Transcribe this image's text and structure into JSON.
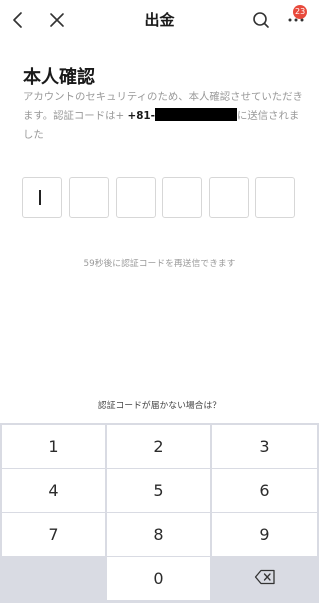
{
  "header": {
    "title": "出金",
    "badge": "23",
    "back_icon": "chevron-left-icon",
    "close_icon": "close-icon",
    "search_icon": "search-icon",
    "more_icon": "more-icon"
  },
  "main": {
    "heading": "本人確認",
    "description_prefix": "アカウントのセキュリティのため、本人確認させていただきます。認証コードは+ ",
    "phone_prefix": "+81-",
    "description_suffix": "に送信されました",
    "resend_text": "59秒後に認証コードを再送信できます",
    "help_text": "認証コードが届かない場合は？",
    "code_boxes": [
      "",
      "",
      "",
      "",
      "",
      ""
    ]
  },
  "keypad": {
    "keys": [
      "1",
      "2",
      "3",
      "4",
      "5",
      "6",
      "7",
      "8",
      "9",
      "",
      "0",
      ""
    ],
    "backspace_icon": "backspace-icon"
  },
  "colors": {
    "accent_badge": "#e84a3c",
    "secondary_text": "#999999",
    "keypad_background": "#d9dbe3"
  }
}
